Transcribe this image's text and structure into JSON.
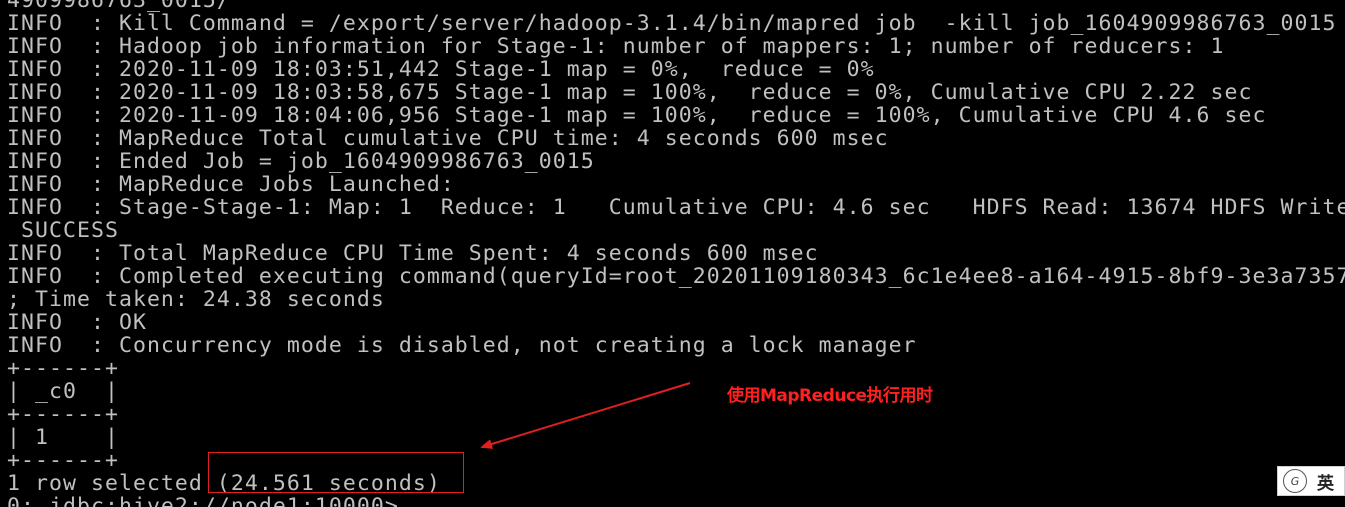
{
  "terminal": {
    "lines": [
      "4909986763_0015/",
      "INFO  : Kill Command = /export/server/hadoop-3.1.4/bin/mapred job  -kill job_1604909986763_0015",
      "INFO  : Hadoop job information for Stage-1: number of mappers: 1; number of reducers: 1",
      "INFO  : 2020-11-09 18:03:51,442 Stage-1 map = 0%,  reduce = 0%",
      "INFO  : 2020-11-09 18:03:58,675 Stage-1 map = 100%,  reduce = 0%, Cumulative CPU 2.22 sec",
      "INFO  : 2020-11-09 18:04:06,956 Stage-1 map = 100%,  reduce = 100%, Cumulative CPU 4.6 sec",
      "INFO  : MapReduce Total cumulative CPU time: 4 seconds 600 msec",
      "INFO  : Ended Job = job_1604909986763_0015",
      "INFO  : MapReduce Jobs Launched:",
      "INFO  : Stage-Stage-1: Map: 1  Reduce: 1   Cumulative CPU: 4.6 sec   HDFS Read: 13674 HDFS Write",
      " SUCCESS",
      "INFO  : Total MapReduce CPU Time Spent: 4 seconds 600 msec",
      "INFO  : Completed executing command(queryId=root_20201109180343_6c1e4ee8-a164-4915-8bf9-3e3a7357",
      "; Time taken: 24.38 seconds",
      "INFO  : OK",
      "INFO  : Concurrency mode is disabled, not creating a lock manager",
      "+------+",
      "| _c0  |",
      "+------+",
      "| 1    |",
      "+------+",
      "1 row selected (24.561 seconds)",
      "0: jdbc:hive2://node1:10000>"
    ]
  },
  "annotation": {
    "label": "使用MapReduce执行用时",
    "color": "#ff2020"
  },
  "ime": {
    "logo_icon": "ime-logo-icon",
    "logo_glyph": "G",
    "mode_label": "英"
  },
  "colors": {
    "background": "#000000",
    "text": "#c0c0c0",
    "highlight": "#e02020"
  }
}
